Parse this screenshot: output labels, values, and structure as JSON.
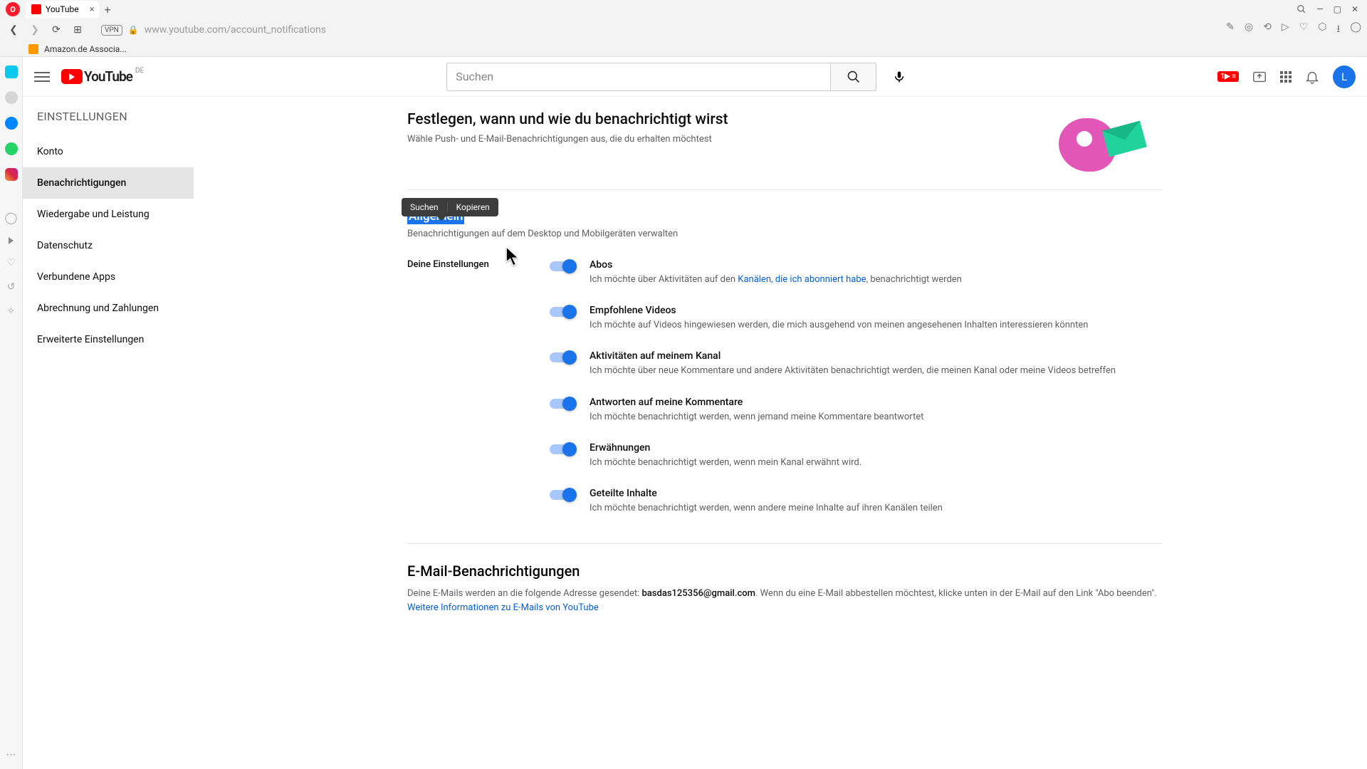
{
  "browser": {
    "tab_title": "YouTube",
    "url": "www.youtube.com/account_notifications",
    "vpn": "VPN",
    "bookmark1": "Amazon.de Associa..."
  },
  "yt_header": {
    "logo_text": "YouTube",
    "country": "DE",
    "search_placeholder": "Suchen",
    "avatar_letter": "L"
  },
  "sidebar": {
    "title": "EINSTELLUNGEN",
    "items": [
      {
        "label": "Konto"
      },
      {
        "label": "Benachrichtigungen"
      },
      {
        "label": "Wiedergabe und Leistung"
      },
      {
        "label": "Datenschutz"
      },
      {
        "label": "Verbundene Apps"
      },
      {
        "label": "Abrechnung und Zahlungen"
      },
      {
        "label": "Erweiterte Einstellungen"
      }
    ]
  },
  "page": {
    "title": "Festlegen, wann und wie du benachrichtigt wirst",
    "subtitle": "Wähle Push- und E-Mail-Benachrichtigungen aus, die du erhalten möchtest"
  },
  "tooltip": {
    "search": "Suchen",
    "copy": "Kopieren"
  },
  "general": {
    "heading": "Allgemein",
    "sub": "Benachrichtigungen auf dem Desktop und Mobilgeräten verwalten",
    "block_label": "Deine Einstellungen",
    "items": [
      {
        "title": "Abos",
        "desc_pre": "Ich möchte über Aktivitäten auf den ",
        "link": "Kanälen, die ich abonniert habe",
        "desc_post": ", benachrichtigt werden"
      },
      {
        "title": "Empfohlene Videos",
        "desc": "Ich möchte auf Videos hingewiesen werden, die mich ausgehend von meinen angesehenen Inhalten interessieren könnten"
      },
      {
        "title": "Aktivitäten auf meinem Kanal",
        "desc": "Ich möchte über neue Kommentare und andere Aktivitäten benachrichtigt werden, die meinen Kanal oder meine Videos betreffen"
      },
      {
        "title": "Antworten auf meine Kommentare",
        "desc": "Ich möchte benachrichtigt werden, wenn jemand meine Kommentare beantwortet"
      },
      {
        "title": "Erwähnungen",
        "desc": "Ich möchte benachrichtigt werden, wenn mein Kanal erwähnt wird."
      },
      {
        "title": "Geteilte Inhalte",
        "desc": "Ich möchte benachrichtigt werden, wenn andere meine Inhalte auf ihren Kanälen teilen"
      }
    ]
  },
  "email": {
    "heading": "E-Mail-Benachrichtigungen",
    "desc_pre": "Deine E-Mails werden an die folgende Adresse gesendet: ",
    "address": "basdas125356@gmail.com",
    "desc_mid": ". Wenn du eine E-Mail abbestellen möchtest, klicke unten in der E-Mail auf den Link \"Abo beenden\". ",
    "link": "Weitere Informationen zu E-Mails von YouTube"
  }
}
